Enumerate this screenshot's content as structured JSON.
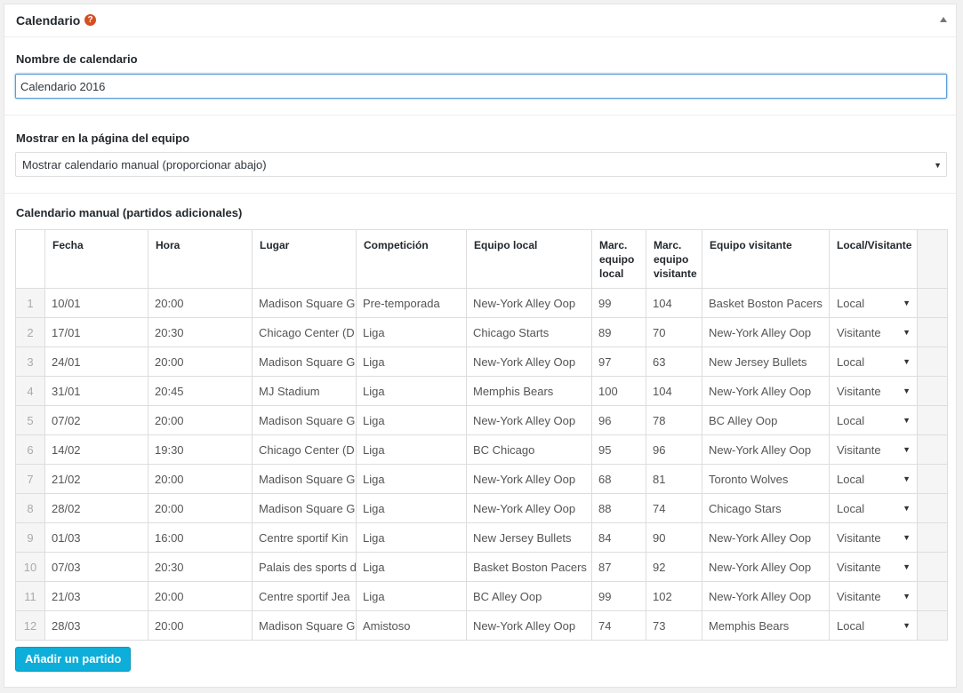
{
  "panel": {
    "title": "Calendario",
    "help_icon": "question-icon",
    "collapse_icon": "triangle-up-icon"
  },
  "name_section": {
    "label": "Nombre de calendario",
    "value": "Calendario 2016"
  },
  "display_section": {
    "label": "Mostrar en la página del equipo",
    "selected": "Mostrar calendario manual (proporcionar abajo)"
  },
  "manual_section": {
    "label": "Calendario manual (partidos adicionales)",
    "columns": [
      "Fecha",
      "Hora",
      "Lugar",
      "Competición",
      "Equipo local",
      "Marc. equipo local",
      "Marc. equipo visitante",
      "Equipo visitante",
      "Local/Visitante"
    ],
    "rows": [
      {
        "n": "1",
        "date": "10/01",
        "time": "20:00",
        "venue": "Madison Square G",
        "comp": "Pre-temporada",
        "home": "New-York Alley Oop",
        "hs": "99",
        "as": "104",
        "away": "Basket Boston Pacers",
        "side": "Local"
      },
      {
        "n": "2",
        "date": "17/01",
        "time": "20:30",
        "venue": "Chicago Center (D",
        "comp": "Liga",
        "home": "Chicago Starts",
        "hs": "89",
        "as": "70",
        "away": "New-York Alley Oop",
        "side": "Visitante"
      },
      {
        "n": "3",
        "date": "24/01",
        "time": "20:00",
        "venue": "Madison Square G",
        "comp": "Liga",
        "home": "New-York Alley Oop",
        "hs": "97",
        "as": "63",
        "away": "New Jersey Bullets",
        "side": "Local"
      },
      {
        "n": "4",
        "date": "31/01",
        "time": "20:45",
        "venue": "MJ Stadium",
        "comp": "Liga",
        "home": "Memphis Bears",
        "hs": "100",
        "as": "104",
        "away": "New-York Alley Oop",
        "side": "Visitante"
      },
      {
        "n": "5",
        "date": "07/02",
        "time": "20:00",
        "venue": "Madison Square G",
        "comp": "Liga",
        "home": "New-York Alley Oop",
        "hs": "96",
        "as": "78",
        "away": "BC Alley Oop",
        "side": "Local"
      },
      {
        "n": "6",
        "date": "14/02",
        "time": "19:30",
        "venue": "Chicago Center (D",
        "comp": "Liga",
        "home": "BC Chicago",
        "hs": "95",
        "as": "96",
        "away": "New-York Alley Oop",
        "side": "Visitante"
      },
      {
        "n": "7",
        "date": "21/02",
        "time": "20:00",
        "venue": "Madison Square G",
        "comp": "Liga",
        "home": "New-York Alley Oop",
        "hs": "68",
        "as": "81",
        "away": "Toronto Wolves",
        "side": "Local"
      },
      {
        "n": "8",
        "date": "28/02",
        "time": "20:00",
        "venue": "Madison Square G",
        "comp": "Liga",
        "home": "New-York Alley Oop",
        "hs": "88",
        "as": "74",
        "away": "Chicago Stars",
        "side": "Local"
      },
      {
        "n": "9",
        "date": "01/03",
        "time": "16:00",
        "venue": "Centre sportif Kin",
        "comp": "Liga",
        "home": "New Jersey Bullets",
        "hs": "84",
        "as": "90",
        "away": "New-York Alley Oop",
        "side": "Visitante"
      },
      {
        "n": "10",
        "date": "07/03",
        "time": "20:30",
        "venue": "Palais des sports d",
        "comp": "Liga",
        "home": "Basket Boston Pacers",
        "hs": "87",
        "as": "92",
        "away": "New-York Alley Oop",
        "side": "Visitante"
      },
      {
        "n": "11",
        "date": "21/03",
        "time": "20:00",
        "venue": "Centre sportif Jea",
        "comp": "Liga",
        "home": "BC Alley Oop",
        "hs": "99",
        "as": "102",
        "away": "New-York Alley Oop",
        "side": "Visitante"
      },
      {
        "n": "12",
        "date": "28/03",
        "time": "20:00",
        "venue": "Madison Square G",
        "comp": "Amistoso",
        "home": "New-York Alley Oop",
        "hs": "74",
        "as": "73",
        "away": "Memphis Bears",
        "side": "Local"
      }
    ]
  },
  "add_button_label": "Añadir un partido"
}
